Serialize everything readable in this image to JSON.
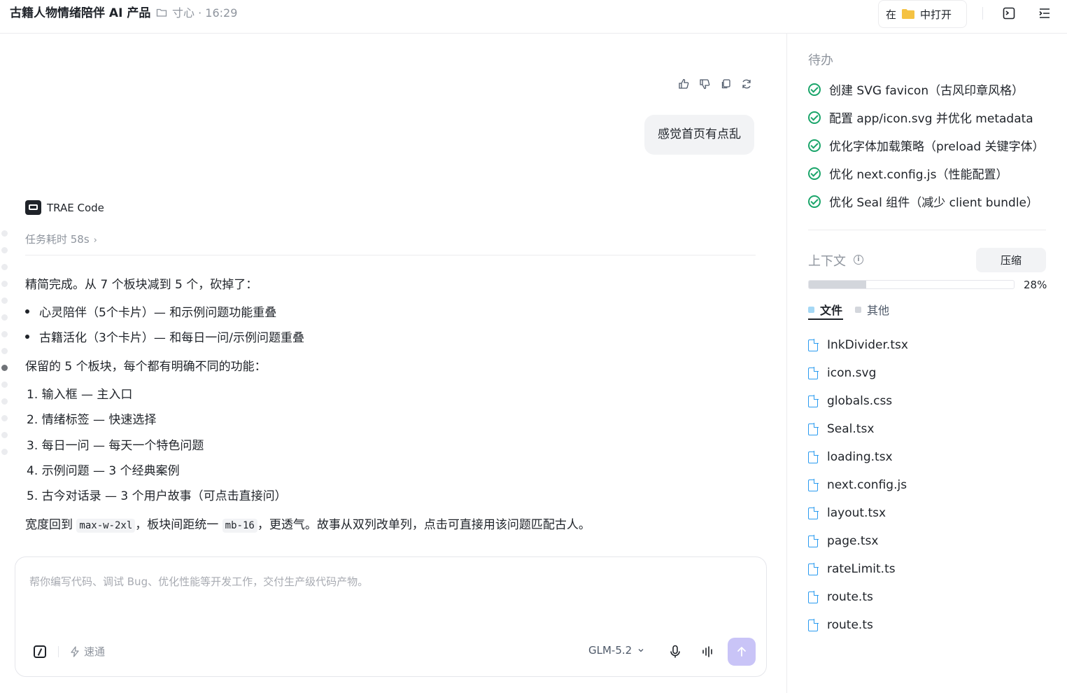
{
  "header": {
    "title": "古籍人物情绪陪伴 AI 产品",
    "meta": "寸心 · 16:29",
    "open_in_prefix": "在",
    "open_in_suffix": "中打开"
  },
  "chat": {
    "user_message": "感觉首页有点乱",
    "assistant_name": "TRAE Code",
    "duration": "任务耗时 58s",
    "reply": {
      "intro": "精简完成。从 7 个板块减到 5 个，砍掉了：",
      "removed": [
        "心灵陪伴（5个卡片）— 和示例问题功能重叠",
        "古籍活化（3个卡片）— 和每日一问/示例问题重叠"
      ],
      "kept_intro": "保留的 5 个板块，每个都有明确不同的功能：",
      "kept": [
        "1. 输入框 — 主入口",
        "2. 情绪标签 — 快速选择",
        "3. 每日一问 — 每天一个特色问题",
        "4. 示例问题 — 3 个经典案例",
        "5. 古今对话录 — 3 个用户故事（可点击直接问）"
      ],
      "outro_1": "宽度回到 ",
      "outro_code_1": "max-w-2xl",
      "outro_2": "，板块间距统一 ",
      "outro_code_2": "mb-16",
      "outro_3": "，更透气。故事从双列改单列，点击可直接用该问题匹配古人。"
    }
  },
  "composer": {
    "placeholder": "帮你编写代码、调试 Bug、优化性能等开发工作，交付生产级代码产物。",
    "speed_label": "速通",
    "model": "GLM-5.2"
  },
  "sidebar": {
    "todo_title": "待办",
    "todos": [
      "创建 SVG favicon（古风印章风格）",
      "配置 app/icon.svg 并优化 metadata",
      "优化字体加载策略（preload 关键字体）",
      "优化 next.config.js（性能配置）",
      "优化 Seal 组件（减少 client bundle）"
    ],
    "context_title": "上下文",
    "compress_label": "压缩",
    "context_usage_pct": 28,
    "context_usage_label": "28%",
    "tabs": [
      "文件",
      "其他"
    ],
    "files": [
      "InkDivider.tsx",
      "icon.svg",
      "globals.css",
      "Seal.tsx",
      "loading.tsx",
      "next.config.js",
      "layout.tsx",
      "page.tsx",
      "rateLimit.ts",
      "route.ts",
      "route.ts"
    ]
  },
  "colors": {
    "accent_send": "#c9c4f7",
    "check_green": "#1aa56a",
    "file_blue": "#2a9bf0",
    "folder_yellow": "#f5c242"
  }
}
